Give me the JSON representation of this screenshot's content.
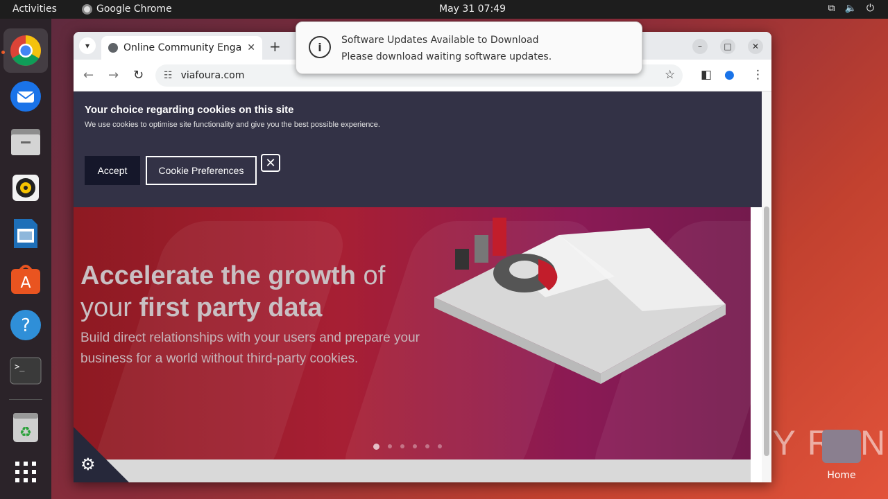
{
  "topbar": {
    "activities": "Activities",
    "app_name": "Google Chrome",
    "clock": "May 31  07:49"
  },
  "dock": {
    "items": [
      "chrome",
      "thunderbird",
      "files",
      "rhythmbox",
      "libreoffice-writer",
      "app-center",
      "help",
      "terminal",
      "trash",
      "show-apps"
    ]
  },
  "browser": {
    "tab_title": "Online Community Enga",
    "url": "viafoura.com"
  },
  "cookie_banner": {
    "title": "Your choice regarding cookies on this site",
    "text": "We use cookies to optimise site functionality and give you the best possible experience.",
    "accept": "Accept",
    "preferences": "Cookie Preferences"
  },
  "hero": {
    "headline_bold_1": "Accelerate the growth",
    "headline_normal_1": " of",
    "headline_normal_2": "your ",
    "headline_bold_2": "first party data",
    "subtitle": "Build direct relationships with your users and prepare your business for a world without third-party cookies.",
    "slides": 6,
    "active_slide": 1
  },
  "notification": {
    "title": "Software Updates Available to Download",
    "body": "Please download waiting software updates."
  },
  "desktop": {
    "home_label": "Home",
    "watermark": "ANY RUN"
  },
  "colors": {
    "accent": "#e95420",
    "cookie_bg": "#333246",
    "hero_red": "#a71f34"
  }
}
